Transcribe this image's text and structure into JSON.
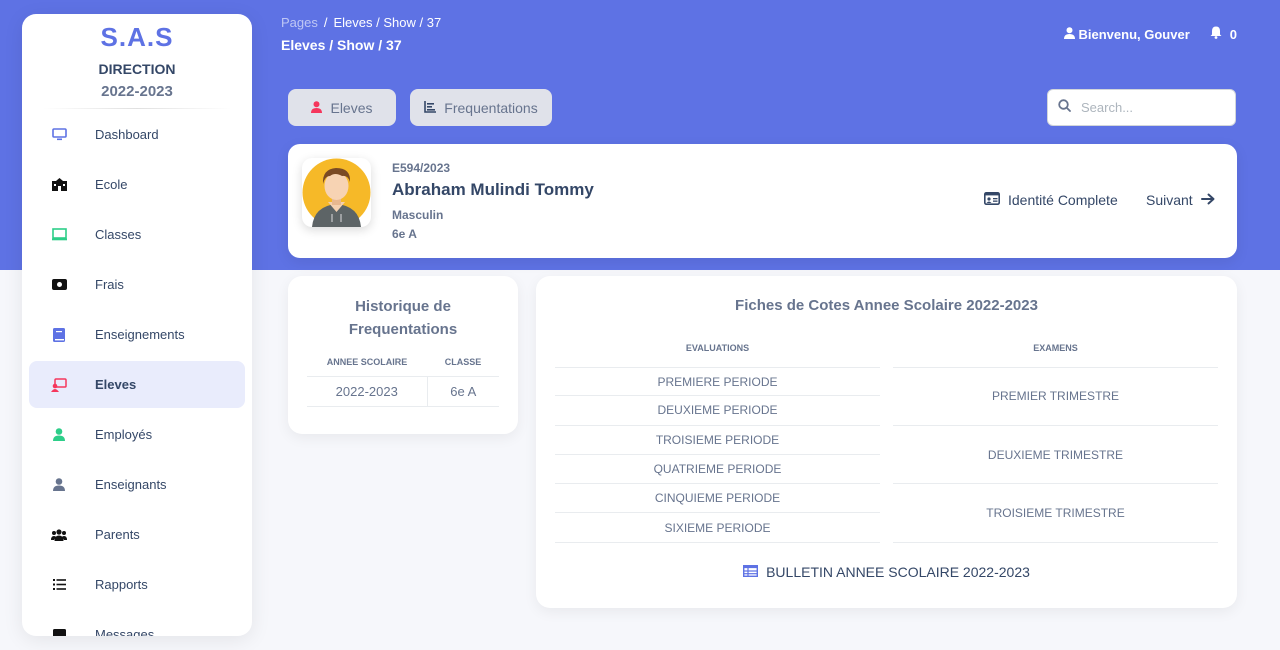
{
  "sidebar": {
    "brand_title": "S.A.S",
    "brand_subtitle": "DIRECTION",
    "brand_year": "2022-2023",
    "items": [
      {
        "label": "Dashboard",
        "icon": "monitor-icon",
        "color": "#5e72e4"
      },
      {
        "label": "Ecole",
        "icon": "school-icon",
        "color": "#111111"
      },
      {
        "label": "Classes",
        "icon": "board-icon",
        "color": "#2dce89"
      },
      {
        "label": "Frais",
        "icon": "money-icon",
        "color": "#111111"
      },
      {
        "label": "Enseignements",
        "icon": "book-icon",
        "color": "#5e72e4"
      },
      {
        "label": "Eleves",
        "icon": "student-icon",
        "color": "#f5365c",
        "active": true
      },
      {
        "label": "Employés",
        "icon": "user-icon",
        "color": "#2dce89"
      },
      {
        "label": "Enseignants",
        "icon": "teacher-icon",
        "color": "#67748e"
      },
      {
        "label": "Parents",
        "icon": "users-icon",
        "color": "#111111"
      },
      {
        "label": "Rapports",
        "icon": "list-icon",
        "color": "#111111"
      },
      {
        "label": "Messages",
        "icon": "message-icon",
        "color": "#111111"
      }
    ]
  },
  "header": {
    "breadcrumb": {
      "root": "Pages",
      "sep": "/",
      "current": "Eleves / Show / 37"
    },
    "title": "Eleves / Show / 37",
    "user_greeting": "Bienvenu, Gouver",
    "notification_count": "0"
  },
  "tabs": {
    "eleves_label": "Eleves",
    "frequentations_label": "Frequentations"
  },
  "search": {
    "placeholder": "Search..."
  },
  "student": {
    "code": "E594/2023",
    "name": "Abraham Mulindi Tommy",
    "gender": "Masculin",
    "class": "6e A",
    "identity_label": "Identité Complete",
    "next_label": "Suivant"
  },
  "history": {
    "title_line1": "Historique de",
    "title_line2": "Frequentations",
    "col_year": "ANNEE SCOLAIRE",
    "col_class": "CLASSE",
    "rows": [
      {
        "year": "2022-2023",
        "class": "6e A"
      }
    ]
  },
  "fiches": {
    "title": "Fiches de Cotes Annee Scolaire 2022-2023",
    "col_evaluations": "EVALUATIONS",
    "col_examens": "EXAMENS",
    "evaluations": [
      "PREMIERE PERIODE",
      "DEUXIEME PERIODE",
      "TROISIEME PERIODE",
      "QUATRIEME PERIODE",
      "CINQUIEME PERIODE",
      "SIXIEME PERIODE"
    ],
    "examens": [
      "PREMIER TRIMESTRE",
      "DEUXIEME TRIMESTRE",
      "TROISIEME TRIMESTRE"
    ],
    "bulletin_label": "BULLETIN ANNEE SCOLAIRE 2022-2023"
  },
  "colors": {
    "primary": "#5e72e4",
    "text": "#344767",
    "muted": "#67748e",
    "danger": "#f5365c",
    "success": "#2dce89"
  }
}
